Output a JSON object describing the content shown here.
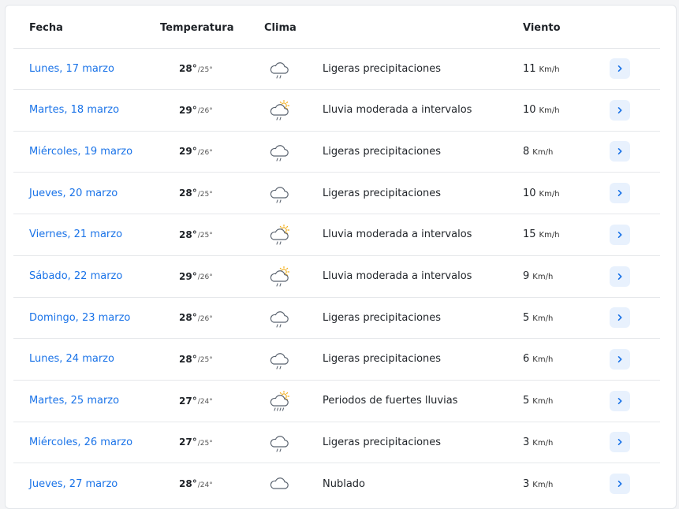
{
  "header": {
    "fecha": "Fecha",
    "temperatura": "Temperatura",
    "clima": "Clima",
    "viento": "Viento"
  },
  "colors": {
    "link": "#1a73e8",
    "button_bg": "#e8f1fd",
    "divider": "#e6e8eb"
  },
  "rows": [
    {
      "date": "Lunes, 17 marzo",
      "max": "28",
      "min": "25°",
      "icon": "cloud-drizzle-icon",
      "desc": "Ligeras precipitaciones",
      "wind": "11",
      "unit": "Km/h"
    },
    {
      "date": "Martes, 18 marzo",
      "max": "29",
      "min": "26°",
      "icon": "sun-cloud-rain-icon",
      "desc": "Lluvia moderada a intervalos",
      "wind": "10",
      "unit": "Km/h"
    },
    {
      "date": "Miércoles, 19 marzo",
      "max": "29",
      "min": "26°",
      "icon": "cloud-drizzle-icon",
      "desc": "Ligeras precipitaciones",
      "wind": "8",
      "unit": "Km/h"
    },
    {
      "date": "Jueves, 20 marzo",
      "max": "28",
      "min": "25°",
      "icon": "cloud-drizzle-icon",
      "desc": "Ligeras precipitaciones",
      "wind": "10",
      "unit": "Km/h"
    },
    {
      "date": "Viernes, 21 marzo",
      "max": "28",
      "min": "25°",
      "icon": "sun-cloud-rain-icon",
      "desc": "Lluvia moderada a intervalos",
      "wind": "15",
      "unit": "Km/h"
    },
    {
      "date": "Sábado, 22 marzo",
      "max": "29",
      "min": "26°",
      "icon": "sun-cloud-rain-icon",
      "desc": "Lluvia moderada a intervalos",
      "wind": "9",
      "unit": "Km/h"
    },
    {
      "date": "Domingo, 23 marzo",
      "max": "28",
      "min": "26°",
      "icon": "cloud-drizzle-icon",
      "desc": "Ligeras precipitaciones",
      "wind": "5",
      "unit": "Km/h"
    },
    {
      "date": "Lunes, 24 marzo",
      "max": "28",
      "min": "25°",
      "icon": "cloud-drizzle-icon",
      "desc": "Ligeras precipitaciones",
      "wind": "6",
      "unit": "Km/h"
    },
    {
      "date": "Martes, 25 marzo",
      "max": "27",
      "min": "24°",
      "icon": "sun-cloud-heavy-rain-icon",
      "desc": "Periodos de fuertes lluvias",
      "wind": "5",
      "unit": "Km/h"
    },
    {
      "date": "Miércoles, 26 marzo",
      "max": "27",
      "min": "25°",
      "icon": "cloud-drizzle-icon",
      "desc": "Ligeras precipitaciones",
      "wind": "3",
      "unit": "Km/h"
    },
    {
      "date": "Jueves, 27 marzo",
      "max": "28",
      "min": "24°",
      "icon": "cloud-icon",
      "desc": "Nublado",
      "wind": "3",
      "unit": "Km/h"
    }
  ]
}
